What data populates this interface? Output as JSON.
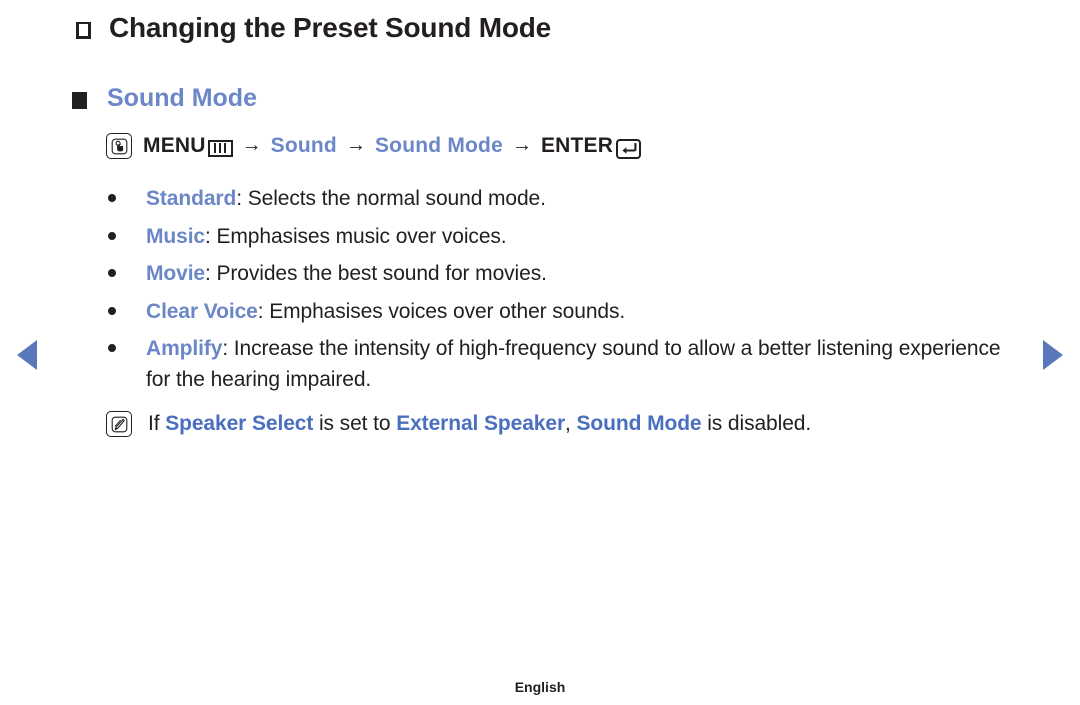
{
  "page": {
    "title": "Changing the Preset Sound Mode",
    "footer_language": "English",
    "accent_blue": "#6b87c7",
    "note_blue": "#4a6fc0",
    "text_color": "#231f20",
    "nav_arrow_color": "#5878ba"
  },
  "section": {
    "heading": "Sound Mode",
    "bullet_icon": "filled-square-bullet"
  },
  "menu_path": {
    "icon": "hand-press-button-icon",
    "menu_label": "MENU",
    "menu_icon": "menu-bars-icon",
    "arrow": "→",
    "step_sound": "Sound",
    "step_sound_mode": "Sound Mode",
    "enter_label": "ENTER",
    "enter_icon": "enter-return-icon"
  },
  "options": [
    {
      "term": "Standard",
      "separator": ": ",
      "description": "Selects the normal sound mode."
    },
    {
      "term": "Music",
      "separator": ": ",
      "description": "Emphasises music over voices."
    },
    {
      "term": "Movie",
      "separator": ": ",
      "description": "Provides the best sound for movies."
    },
    {
      "term": "Clear Voice",
      "separator": ": ",
      "description": "Emphasises voices over other sounds."
    },
    {
      "term": "Amplify",
      "separator": ": ",
      "description": "Increase the intensity of high-frequency sound to allow a better listening experience for the hearing impaired."
    }
  ],
  "note": {
    "icon": "note-pencil-icon",
    "prefix": "If ",
    "term1": "Speaker Select",
    "middle1": " is set to ",
    "term2": "External Speaker",
    "middle2": ", ",
    "term3": "Sound Mode",
    "suffix": " is disabled."
  },
  "navigation": {
    "prev_label": "Previous page",
    "next_label": "Next page"
  }
}
